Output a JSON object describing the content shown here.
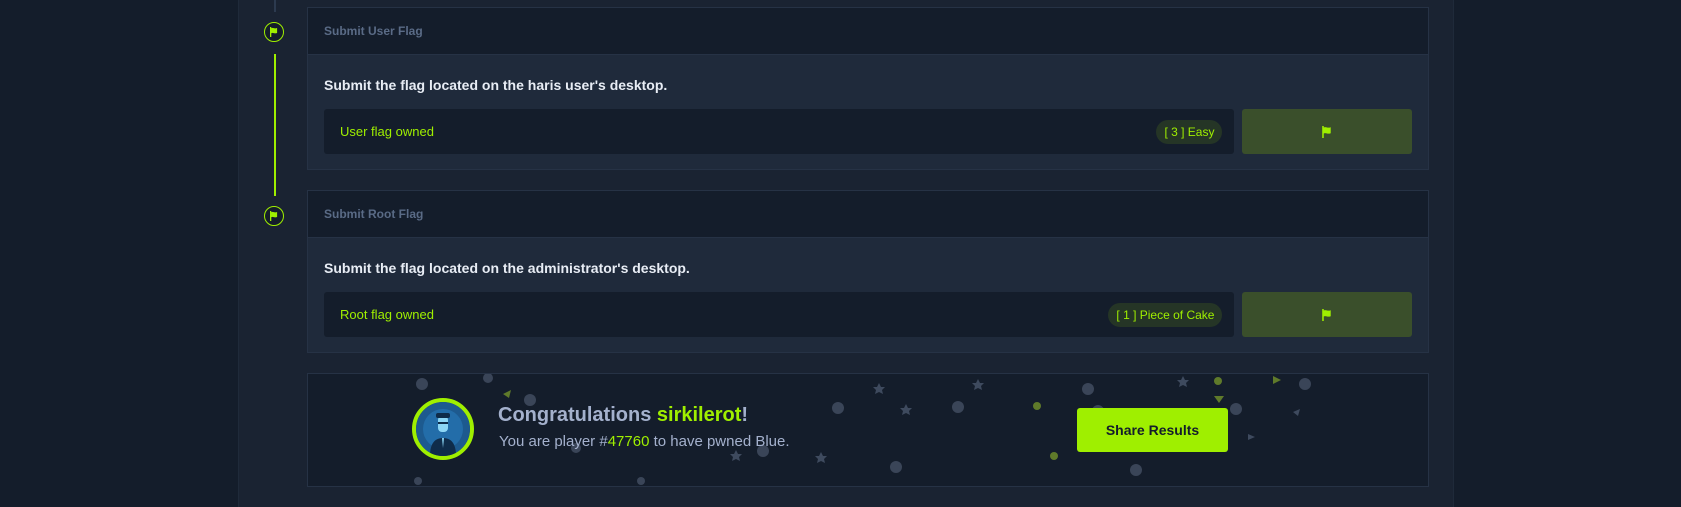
{
  "tasks": [
    {
      "header": "Submit User Flag",
      "description": "Submit the flag located on the haris user's desktop.",
      "answer": "User flag owned",
      "difficulty": "[ 3 ] Easy"
    },
    {
      "header": "Submit Root Flag",
      "description": "Submit the flag located on the administrator's desktop.",
      "answer": "Root flag owned",
      "difficulty": "[ 1 ] Piece of Cake"
    }
  ],
  "congrats": {
    "prefix": "Congratulations ",
    "username": "sirkilerot",
    "suffix": "!",
    "sub_prefix": "You are player #",
    "player_number": "47760",
    "sub_suffix": " to have pwned Blue.",
    "share_label": "Share Results"
  },
  "icons": {
    "flag": "flag-icon",
    "avatar": "agent-avatar"
  },
  "colors": {
    "accent": "#9fef00",
    "bg": "#141d2b",
    "panel": "#1f2a3b",
    "muted": "#a4b1cd"
  }
}
